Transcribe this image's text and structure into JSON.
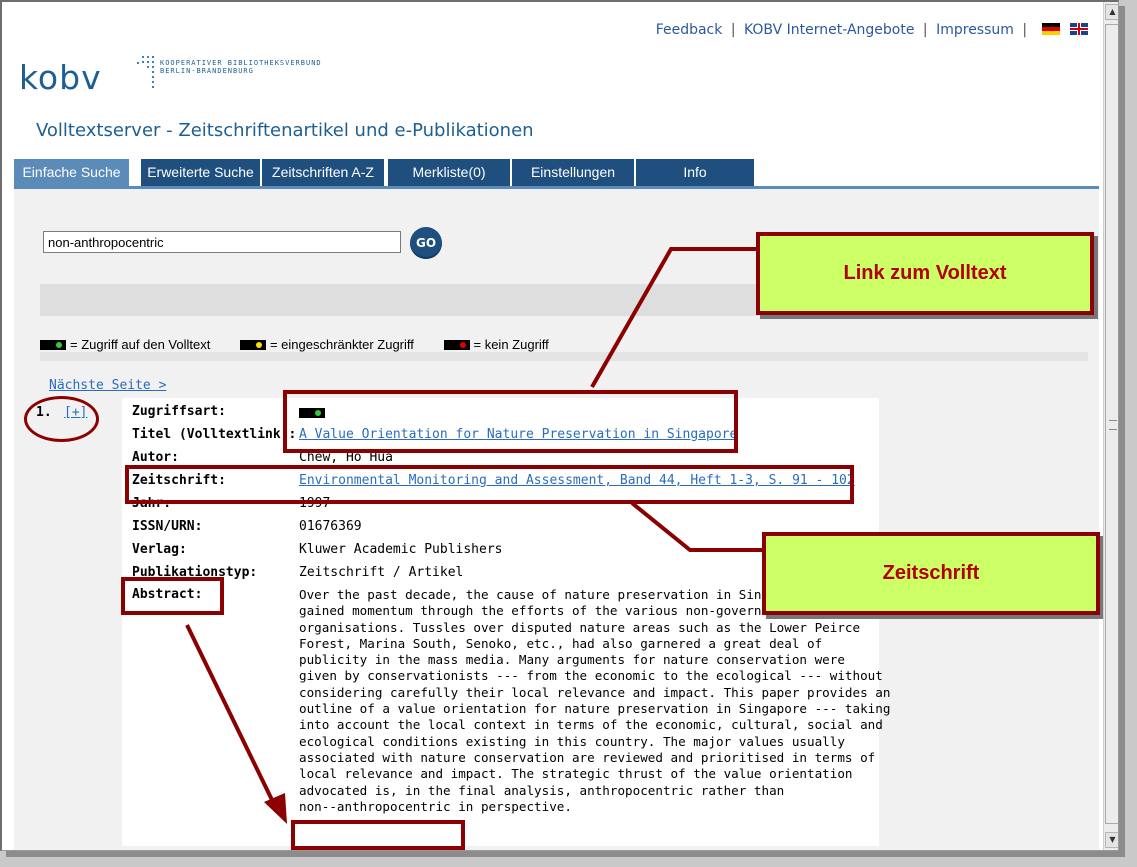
{
  "header": {
    "links": [
      "Feedback",
      "KOBV Internet-Angebote",
      "Impressum"
    ],
    "separator": "|",
    "logo": "kobv",
    "logo_line1": "KOOPERATIVER BIBLIOTHEKSVERBUND",
    "logo_line2": "BERLIN-BRANDENBURG",
    "title": "Volltextserver - Zeitschriftenartikel und e-Publikationen"
  },
  "tabs": [
    {
      "label": "Einfache Suche",
      "active": true
    },
    {
      "label": "Erweiterte Suche",
      "active": false
    },
    {
      "label": "Zeitschriften A-Z",
      "active": false
    },
    {
      "label": "Merkliste(0)",
      "active": false
    },
    {
      "label": "Einstellungen",
      "active": false
    },
    {
      "label": "Info",
      "active": false
    }
  ],
  "search": {
    "value": "non-anthropocentric",
    "go_label": "GO"
  },
  "legend": {
    "full": "= Zugriff auf den Volltext",
    "limited": "= eingeschränkter Zugriff",
    "none": "= kein Zugriff",
    "colors": {
      "full": "#2ecc40",
      "limited": "#ffdd00",
      "none": "#e00000"
    }
  },
  "results": {
    "next_page": "Nächste Seite >",
    "number": "1.",
    "expand": "[+]",
    "fields": {
      "zugriffsart_label": "Zugriffsart:",
      "titel_label": "Titel (Volltextlink):",
      "titel_value": "A Value Orientation for Nature Preservation in Singapore",
      "autor_label": "Autor:",
      "autor_value": "Chew, Ho Hua",
      "zeitschrift_label": "Zeitschrift:",
      "zeitschrift_value": "Environmental Monitoring and Assessment, Band 44, Heft 1-3, S. 91 - 102",
      "jahr_label": "Jahr:",
      "jahr_value": "1997",
      "issn_label": "ISSN/URN:",
      "issn_value": "01676369",
      "verlag_label": "Verlag:",
      "verlag_value": "Kluwer Academic Publishers",
      "typ_label": "Publikationstyp:",
      "typ_value": "Zeitschrift / Artikel",
      "abstract_label": "Abstract:",
      "abstract_value": "Over the past decade, the cause of nature preservation in Singapore has\ngained momentum through the efforts of the various non-governmental\norganisations. Tussles over disputed nature areas such as the Lower Peirce\nForest, Marina South, Senoko, etc., had also garnered a great deal of\npublicity in the mass media. Many arguments for nature conservation were\ngiven by conservationists --- from the economic to the ecological --- without\nconsidering carefully their local relevance and impact. This paper provides an\noutline of a value orientation for nature preservation in Singapore --- taking\ninto account the local context in terms of the economic, cultural, social and\necological conditions existing in this country. The major values usually\nassociated with nature conservation are reviewed and prioritised in terms of\nlocal relevance and impact. The strategic thrust of the value orientation\nadvocated is, in the final analysis, anthropocentric rather than\nnon--anthropocentric in perspective."
    }
  },
  "annotations": {
    "callout_volltext": "Link zum Volltext",
    "callout_zeitschrift": "Zeitschrift",
    "accent": "#8b0000",
    "callout_bg": "#ccff66"
  }
}
